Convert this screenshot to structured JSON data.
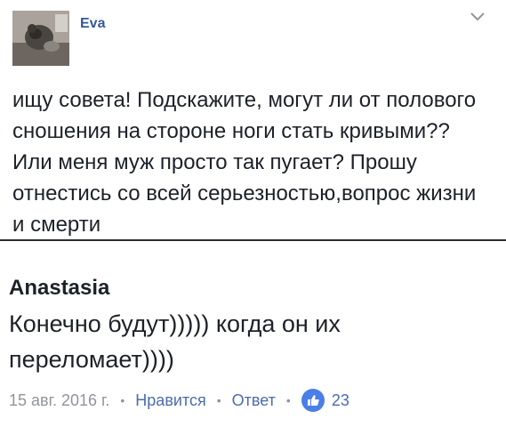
{
  "post": {
    "author": "Eva",
    "text": "ищу совета! Подскажите, могут ли от полового сношения на стороне ноги стать кривыми?? Или меня муж просто так пугает? Прошу отнестись со всей серьезностью,вопрос жизни и смерти"
  },
  "comment": {
    "author": "Anastasia",
    "text": "Конечно будут))))) когда он их переломает))))",
    "date": "15 авг. 2016 г.",
    "like_label": "Нравится",
    "reply_label": "Ответ",
    "like_count": "23"
  },
  "colors": {
    "link_blue": "#365899",
    "meta_gray": "#90949c",
    "like_badge": "#4a7ee8"
  }
}
